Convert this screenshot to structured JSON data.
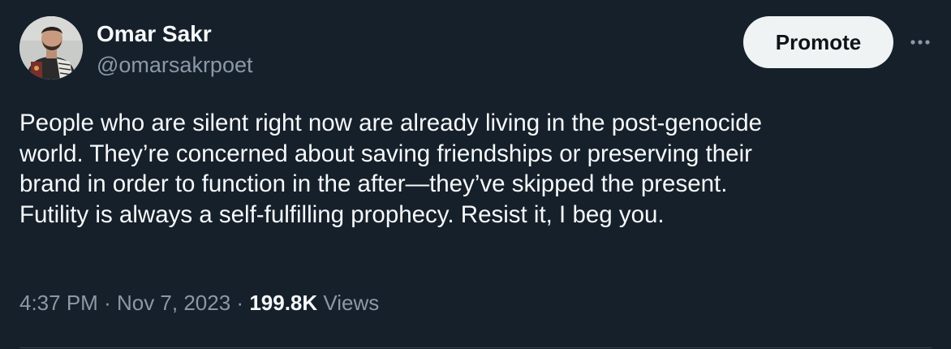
{
  "tweet": {
    "author": {
      "display_name": "Omar Sakr",
      "handle": "@omarsakrpoet",
      "avatar_icon": "profile-photo"
    },
    "promote_label": "Promote",
    "more_icon": "more-horizontal-icon",
    "text_lines": [
      "People who are silent right now are already living in the post-genocide",
      "world. They’re concerned about saving friendships or preserving their",
      "brand in order to function in the after—they’ve skipped the present.",
      "Futility is always a self-fulfilling prophecy. Resist it, I beg you."
    ],
    "time": "4:37 PM",
    "separator": "·",
    "date": "Nov 7, 2023",
    "view_count": "199.8K",
    "views_label": "Views"
  },
  "colors": {
    "background": "#15202b",
    "primary_text": "#f7f9f9",
    "secondary_text": "#8b98a5",
    "button_bg": "#eff3f4"
  }
}
